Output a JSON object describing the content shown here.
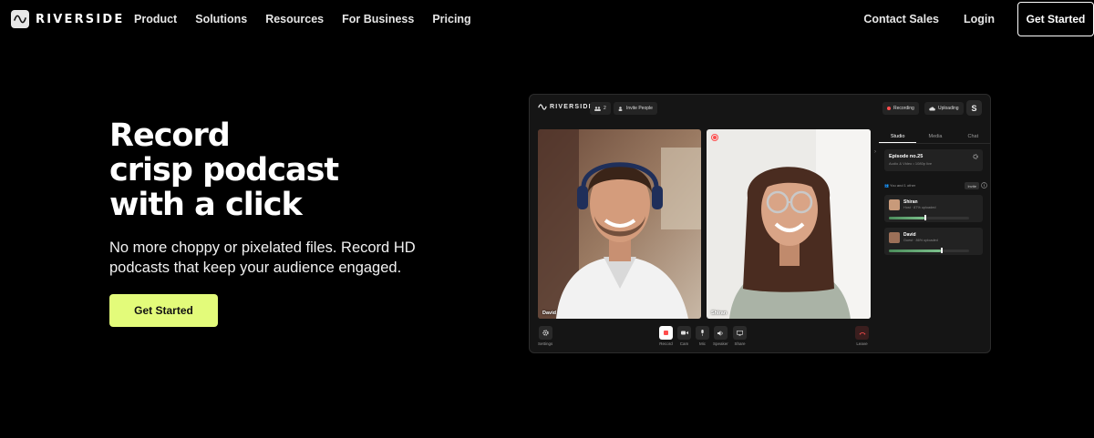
{
  "nav": {
    "logo_text": "RIVERSIDE",
    "links": [
      "Product",
      "Solutions",
      "Resources",
      "For Business",
      "Pricing"
    ],
    "contact_sales": "Contact Sales",
    "login": "Login",
    "get_started": "Get Started"
  },
  "hero": {
    "title_lines": [
      "Record",
      "crisp podcast",
      "with a click"
    ],
    "subtitle": "No more choppy or pixelated files. Record HD podcasts that keep your audience engaged.",
    "cta": "Get Started",
    "cta_color": "#e3fb7a"
  },
  "app": {
    "logo_text": "RIVERSIDE",
    "participant_count": "2",
    "invite_label": "Invite People",
    "recording_label": "Recording",
    "uploading_label": "Uploading",
    "avatar_letter": "S",
    "tiles": [
      {
        "name": "David"
      },
      {
        "name": "Shiran"
      }
    ],
    "controls": {
      "settings": "Settings",
      "record": "Record",
      "cam": "Cam",
      "mic": "Mic",
      "speaker": "Speaker",
      "share": "Share",
      "leave": "Leave"
    },
    "side": {
      "tabs": [
        "Studio",
        "Media",
        "Chat"
      ],
      "episode_title": "Episode no.25",
      "episode_sub": "Audio & Video • 1080p live",
      "you_and_other": "You and 1 other",
      "invite": "Invite",
      "people": [
        {
          "name": "Shiran",
          "meta": "Host · 87% uploaded",
          "progress": 0.87
        },
        {
          "name": "David",
          "meta": "Guest · 86% uploaded",
          "progress": 0.86
        }
      ]
    },
    "status_color": "#ff4d4d",
    "accent_green": "#7cc08c"
  }
}
